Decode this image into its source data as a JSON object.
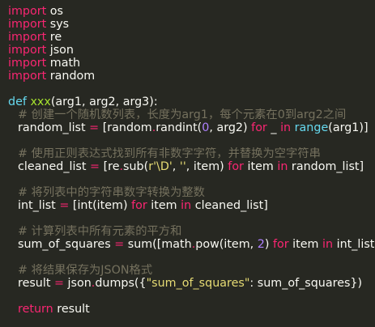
{
  "imports": [
    {
      "keyword": "import",
      "module": "os"
    },
    {
      "keyword": "import",
      "module": "sys"
    },
    {
      "keyword": "import",
      "module": "re"
    },
    {
      "keyword": "import",
      "module": "json"
    },
    {
      "keyword": "import",
      "module": "math"
    },
    {
      "keyword": "import",
      "module": "random"
    }
  ],
  "func": {
    "def": "def",
    "name": "xxx",
    "params": "(arg1, arg2, arg3):"
  },
  "block1": {
    "comment": "# 创建一个随机数列表，长度为arg1，每个元素在0到arg2之间",
    "var": "random_list",
    "eq": " = ",
    "p1": "[random",
    "dot": ".",
    "p2": "randint(",
    "n0": "0",
    "p3": ", arg2) ",
    "for": "for",
    "p4": " _ ",
    "in": "in",
    "p5": " ",
    "range": "range",
    "p6": "(arg1)]"
  },
  "block2": {
    "comment": "# 使用正则表达式找到所有非数字字符，并替换为空字符串",
    "var": "cleaned_list",
    "eq": " = ",
    "p1": "[re",
    "dot": ".",
    "p2": "sub(",
    "s1": "r'\\D'",
    "p3": ", ",
    "s2": "''",
    "p4": ", item) ",
    "for": "for",
    "p5": " item ",
    "in": "in",
    "p6": " random_list]"
  },
  "block3": {
    "comment": "# 将列表中的字符串数字转换为整数",
    "var": "int_list",
    "eq": " = ",
    "p1": "[int(item) ",
    "for": "for",
    "p2": " item ",
    "in": "in",
    "p3": " cleaned_list]"
  },
  "block4": {
    "comment": "# 计算列表中所有元素的平方和",
    "var": "sum_of_squares",
    "eq": " = ",
    "p1": "sum([math",
    "dot": ".",
    "p2": "pow(item, ",
    "n2": "2",
    "p3": ") ",
    "for": "for",
    "p4": " item ",
    "in": "in",
    "p5": " int_list])"
  },
  "block5": {
    "comment": "# 将结果保存为JSON格式",
    "var": "result",
    "eq": " = ",
    "p1": "json",
    "dot": ".",
    "p2": "dumps({",
    "s1": "\"sum_of_squares\"",
    "p3": ": sum_of_squares})"
  },
  "ret": {
    "kw": "return",
    "val": " result"
  }
}
